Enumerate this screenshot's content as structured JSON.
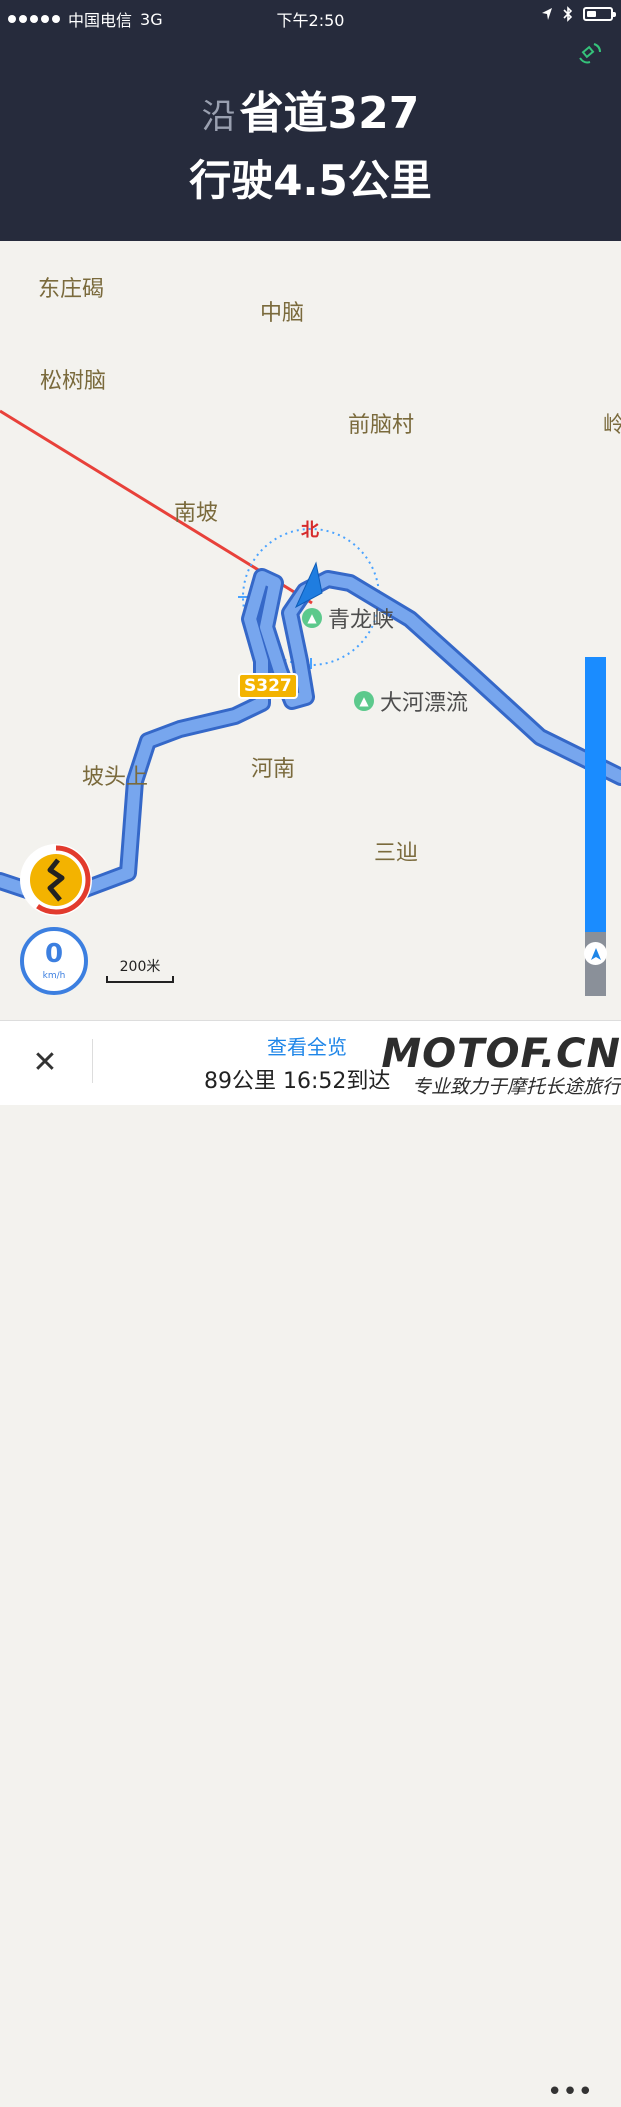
{
  "status_bar": {
    "carrier": "中国电信",
    "network": "3G",
    "time": "下午2:50"
  },
  "navigation": {
    "prefix": "沿",
    "road": "省道327",
    "instruction": "行驶4.5公里"
  },
  "map": {
    "places": [
      "东庄碣",
      "中脑",
      "松树脑",
      "前脑村",
      "岭",
      "南坡",
      "坡头上",
      "河南",
      "三辿"
    ],
    "pois": [
      "青龙峡",
      "大河漂流"
    ],
    "road_shield": "S327",
    "compass_label": "北",
    "scale_label": "200米",
    "speed": {
      "value": "0",
      "unit": "km/h"
    },
    "route_progress": 0.81
  },
  "bottom": {
    "overview_label": "查看全览",
    "eta": "89公里 16:52到达"
  },
  "watermark": {
    "brand": "MOTOF.CN",
    "slogan": "专业致力于摩托长途旅行"
  },
  "icons": [
    "gps-satellite-icon",
    "location-arrow-icon",
    "bluetooth-icon",
    "battery-icon",
    "close-icon",
    "winding-road-warning-icon",
    "navigation-arrow-icon",
    "poi-scenic-icon"
  ],
  "colors": {
    "header_bg": "#262b3c",
    "route": "#4a82e0",
    "accent": "#1f86e8",
    "warning": "#f3b300"
  }
}
